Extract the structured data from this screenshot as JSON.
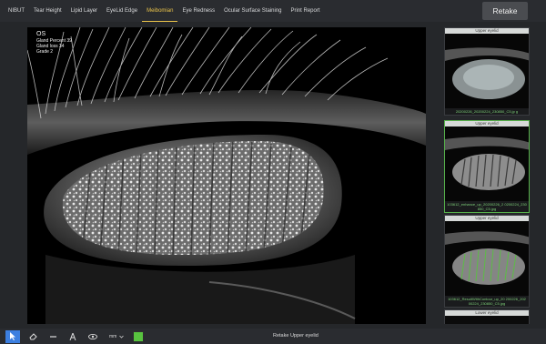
{
  "tabs": [
    {
      "label": "NIBUT"
    },
    {
      "label": "Tear Height"
    },
    {
      "label": "Lipid Layer"
    },
    {
      "label": "EyeLid Edge"
    },
    {
      "label": "Meibomian",
      "active": true
    },
    {
      "label": "Eye Redness"
    },
    {
      "label": "Ocular Surface Staining"
    },
    {
      "label": "Print Report"
    }
  ],
  "retake_label": "Retake",
  "main_image": {
    "eye": "OS",
    "lines": [
      "Gland Percent 39",
      "Gland loss 34",
      "Grade 2"
    ]
  },
  "thumbnails": [
    {
      "label": "Upper eyelid",
      "name": "20200226_20200224_230850_C5.jp g"
    },
    {
      "label": "Upper eyelid",
      "name": "103612_enhance_up_20200226_2 0200224_230850_C5.jpg"
    },
    {
      "label": "Upper eyelid",
      "name": "103612_ResultWithContour_up_20 200226_20200224_230850_C5.jpg"
    },
    {
      "label": "Lower eyelid",
      "name": ""
    }
  ],
  "toolbar": {
    "unit": "mm",
    "status": "Retake Upper eyelid",
    "pen_color": "#58c33f"
  }
}
